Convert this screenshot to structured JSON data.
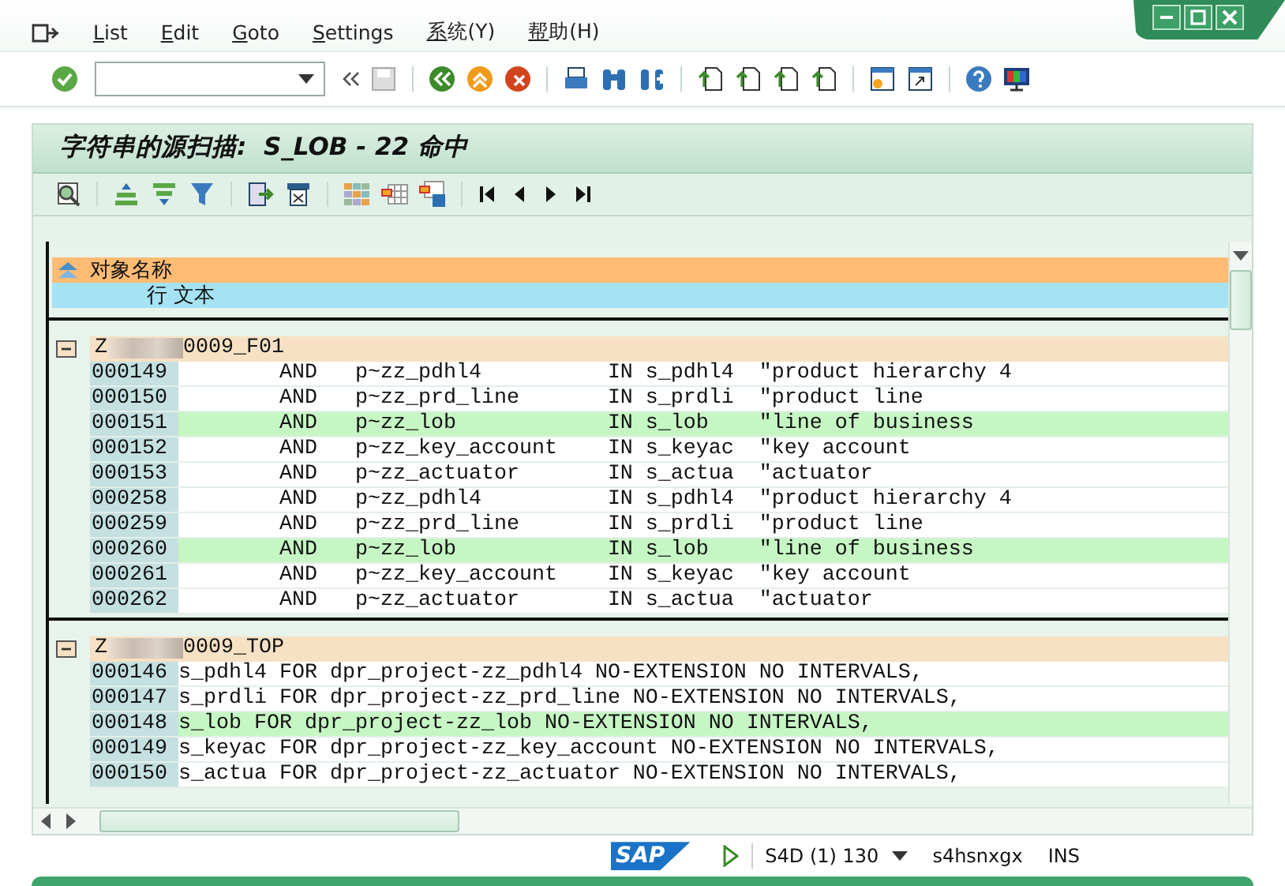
{
  "menu": [
    {
      "label": "List"
    },
    {
      "label": "Edit"
    },
    {
      "label": "Goto"
    },
    {
      "label": "Settings"
    },
    {
      "label": "系统(Y)"
    },
    {
      "label": "帮助(H)"
    }
  ],
  "title": "字符串的源扫描:  S_LOB - 22 命中",
  "header": {
    "row1": "对象名称",
    "row2": "行 文本"
  },
  "groups": [
    {
      "name_start": "Z",
      "name_end": "0009_F01",
      "expanded": true,
      "rows": [
        {
          "line": "000149",
          "code": "        AND   p~zz_pdhl4          IN s_pdhl4  \"product hierarchy 4",
          "highlighted": false
        },
        {
          "line": "000150",
          "code": "        AND   p~zz_prd_line       IN s_prdli  \"product line",
          "highlighted": false
        },
        {
          "line": "000151",
          "code": "        AND   p~zz_lob            IN s_lob    \"line of business",
          "highlighted": true
        },
        {
          "line": "000152",
          "code": "        AND   p~zz_key_account    IN s_keyac  \"key account",
          "highlighted": false
        },
        {
          "line": "000153",
          "code": "        AND   p~zz_actuator       IN s_actua  \"actuator",
          "highlighted": false
        },
        {
          "line": "000258",
          "code": "        AND   p~zz_pdhl4          IN s_pdhl4  \"product hierarchy 4",
          "highlighted": false
        },
        {
          "line": "000259",
          "code": "        AND   p~zz_prd_line       IN s_prdli  \"product line",
          "highlighted": false
        },
        {
          "line": "000260",
          "code": "        AND   p~zz_lob            IN s_lob    \"line of business",
          "highlighted": true
        },
        {
          "line": "000261",
          "code": "        AND   p~zz_key_account    IN s_keyac  \"key account",
          "highlighted": false
        },
        {
          "line": "000262",
          "code": "        AND   p~zz_actuator       IN s_actua  \"actuator",
          "highlighted": false
        }
      ]
    },
    {
      "name_start": "Z",
      "name_end": "0009_TOP",
      "expanded": true,
      "rows": [
        {
          "line": "000146",
          "code": "s_pdhl4 FOR dpr_project-zz_pdhl4 NO-EXTENSION NO INTERVALS,",
          "highlighted": false
        },
        {
          "line": "000147",
          "code": "s_prdli FOR dpr_project-zz_prd_line NO-EXTENSION NO INTERVALS,",
          "highlighted": false
        },
        {
          "line": "000148",
          "code": "s_lob FOR dpr_project-zz_lob NO-EXTENSION NO INTERVALS,",
          "highlighted": true
        },
        {
          "line": "000149",
          "code": "s_keyac FOR dpr_project-zz_key_account NO-EXTENSION NO INTERVALS,",
          "highlighted": false
        },
        {
          "line": "000150",
          "code": "s_actua FOR dpr_project-zz_actuator NO-EXTENSION NO INTERVALS,",
          "highlighted": false
        }
      ]
    }
  ],
  "status": {
    "logo": "SAP",
    "system": "S4D (1) 130",
    "server": "s4hsnxgx",
    "mode": "INS"
  }
}
